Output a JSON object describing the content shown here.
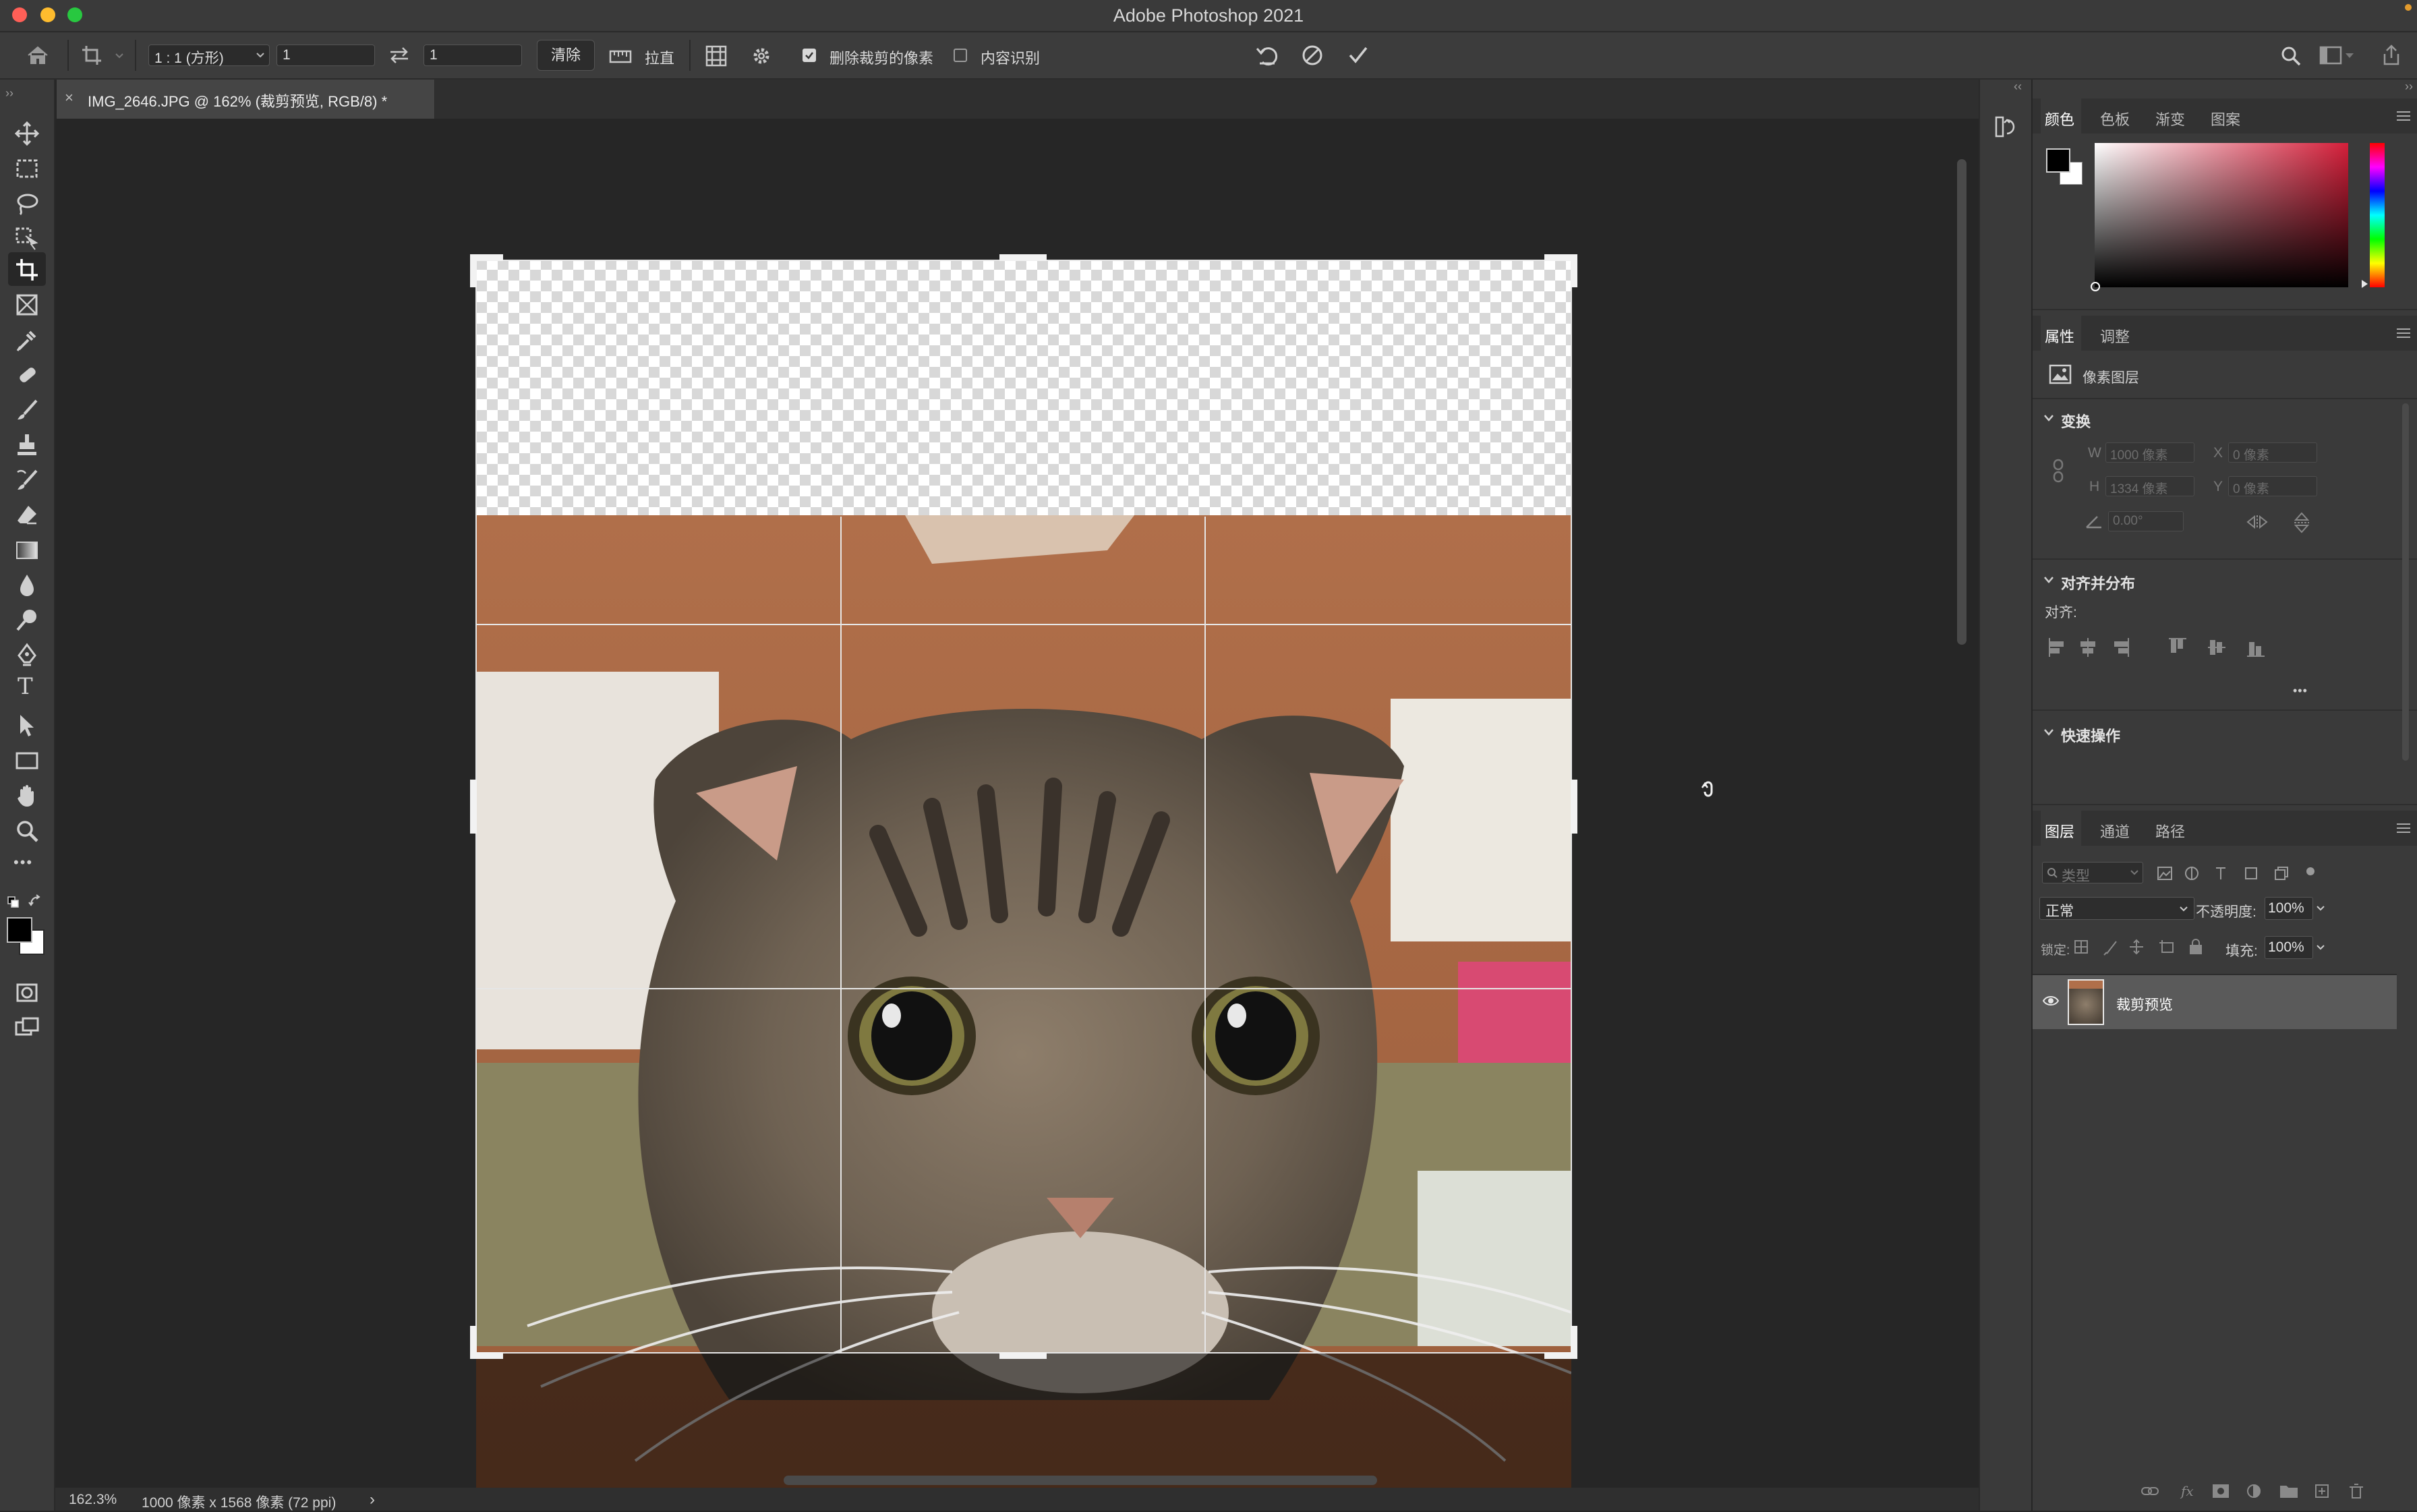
{
  "app": {
    "title": "Adobe Photoshop 2021"
  },
  "options_bar": {
    "ratio_label": "1 : 1 (方形)",
    "width_value": "1",
    "height_value": "1",
    "clear_button": "清除",
    "straighten_label": "拉直",
    "delete_cropped_label": "删除裁剪的像素",
    "delete_cropped_checked": true,
    "content_aware_label": "内容识别",
    "content_aware_checked": false
  },
  "document_tab": {
    "title": "IMG_2646.JPG @ 162% (裁剪预览, RGB/8) *",
    "close": "×"
  },
  "status_bar": {
    "zoom": "162.3%",
    "doc_info": "1000 像素 x 1568 像素 (72 ppi)",
    "arrow": "›"
  },
  "color_panel": {
    "tabs": [
      "颜色",
      "色板",
      "渐变",
      "图案"
    ],
    "active_tab": "颜色",
    "foreground": "#000000",
    "background": "#ffffff",
    "hue_color": "#d51f3a"
  },
  "properties_panel": {
    "tabs": [
      "属性",
      "调整"
    ],
    "active_tab": "属性",
    "layer_type": "像素图层",
    "transform": {
      "header": "变换",
      "w_label": "W",
      "w_value": "1000 像素",
      "x_label": "X",
      "x_value": "0 像素",
      "h_label": "H",
      "h_value": "1334 像素",
      "y_label": "Y",
      "y_value": "0 像素",
      "angle_value": "0.00°"
    },
    "align": {
      "header": "对齐并分布",
      "label": "对齐:",
      "more": "•••"
    },
    "quick_actions": {
      "header": "快速操作"
    }
  },
  "layers_panel": {
    "tabs": [
      "图层",
      "通道",
      "路径"
    ],
    "active_tab": "图层",
    "filter_placeholder": "类型",
    "blend_mode": "正常",
    "opacity_label": "不透明度:",
    "opacity_value": "100%",
    "lock_label": "锁定:",
    "fill_label": "填充:",
    "fill_value": "100%",
    "layers": [
      {
        "name": "裁剪预览",
        "visible": true
      }
    ]
  }
}
